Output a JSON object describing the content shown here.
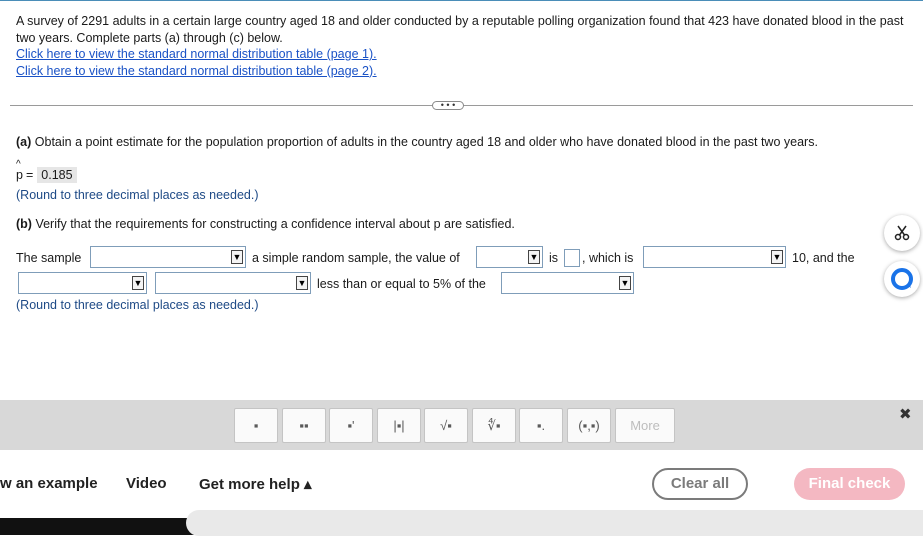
{
  "intro": {
    "text": "A survey of 2291 adults in a certain large country aged 18 and older conducted by a reputable polling organization found that 423 have donated blood in the past two years. Complete parts (a) through (c) below.",
    "link1": "Click here to view the standard normal distribution table (page 1).",
    "link2": "Click here to view the standard normal distribution table (page 2)."
  },
  "divider": {
    "more_label": "• • •"
  },
  "part_a": {
    "label": "(a)",
    "question": "Obtain a point estimate for the population proportion of adults in the country aged 18 and older who have donated blood in the past two years.",
    "phat_symbol": "p",
    "equals": "=",
    "answer": "0.185",
    "hint": "(Round to three decimal places as needed.)"
  },
  "part_b": {
    "label": "(b)",
    "question": "Verify that the requirements for constructing a confidence interval about p are satisfied.",
    "t1": "The sample",
    "t2": "a simple random sample, the value of",
    "t3": "is",
    "t4": ", which is",
    "t5": "10, and the",
    "t6": "less than or equal to 5% of the",
    "hint": "(Round to three decimal places as needed.)",
    "dropdown_values": [
      "",
      "",
      "",
      "",
      "",
      ""
    ]
  },
  "toolbar": {
    "icons": [
      "fraction-icon",
      "mixed-number-icon",
      "exponent-icon",
      "absolute-value-icon",
      "square-root-icon",
      "nth-root-icon",
      "subscript-icon",
      "ordered-pair-icon"
    ],
    "glyphs": [
      "▪",
      "▪▪",
      "▪'",
      "|▪|",
      "√▪",
      "∜▪",
      "▪.",
      "(▪,▪)"
    ],
    "more_label": "More",
    "close_glyph": "✖"
  },
  "footer": {
    "example": "w an example",
    "video": "Video",
    "help": "Get more help ▴",
    "clear": "Clear all",
    "check": "Final check"
  },
  "colors": {
    "link": "#1a52c6",
    "hint": "#1e4a86",
    "final_check_bg": "#f4b8c2",
    "chat_blue": "#1a73e8"
  }
}
